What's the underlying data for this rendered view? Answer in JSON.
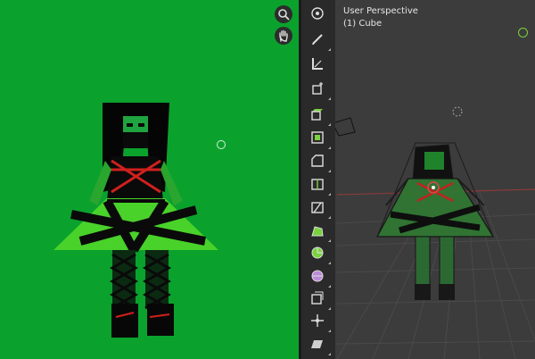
{
  "viewport": {
    "perspective_label": "User Perspective",
    "object_label": "(1) Cube"
  },
  "left_view": {
    "background_color": "#0aa22d",
    "nav_icons": [
      "zoom-icon",
      "hand-pan-icon"
    ]
  },
  "toolbar": {
    "tools": [
      {
        "name": "view-gizmo-icon",
        "active": false
      },
      {
        "name": "annotate-icon",
        "active": false
      },
      {
        "name": "measure-icon",
        "active": false
      },
      {
        "name": "add-cube-icon",
        "active": false
      },
      {
        "name": "extrude-region-icon",
        "active": false
      },
      {
        "name": "inset-faces-icon",
        "active": false
      },
      {
        "name": "bevel-icon",
        "active": false
      },
      {
        "name": "loop-cut-icon",
        "active": false
      },
      {
        "name": "knife-icon",
        "active": false
      },
      {
        "name": "poly-build-icon",
        "active": false
      },
      {
        "name": "spin-icon",
        "active": false
      },
      {
        "name": "smooth-icon",
        "active": false
      },
      {
        "name": "edge-slide-icon",
        "active": false
      },
      {
        "name": "shrink-fatten-icon",
        "active": false
      },
      {
        "name": "shear-icon",
        "active": false
      }
    ]
  }
}
